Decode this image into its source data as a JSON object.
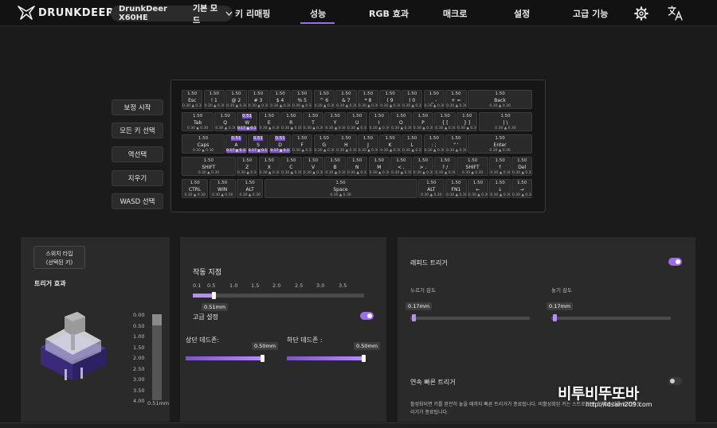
{
  "header": {
    "brand": "DRUNKDEER",
    "device": "DrunkDeer X60HE",
    "mode": "기본 모드",
    "tabs": [
      {
        "label": "키 리매핑"
      },
      {
        "label": "성능"
      },
      {
        "label": "RGB 효과"
      },
      {
        "label": "매크로"
      },
      {
        "label": "설정"
      },
      {
        "label": "고급 기능"
      }
    ],
    "active_tab": "성능",
    "icons": {
      "settings": "gear-icon",
      "language": "translate-icon"
    },
    "accent": "#9b6ee8"
  },
  "side_buttons": [
    "보정 시작",
    "모든 키 선택",
    "역선택",
    "지우기",
    "WASD 선택"
  ],
  "keyboard": {
    "default_value": "1.50",
    "selected_value": "0.51",
    "range_default": "0.30 ▲ 0.30",
    "range_selected": "0.17 ▲ 0.17",
    "rows": [
      [
        {
          "label": "Esc"
        },
        {
          "label": "! 1"
        },
        {
          "label": "@ 2"
        },
        {
          "label": "# 3"
        },
        {
          "label": "$ 4"
        },
        {
          "label": "% 5"
        },
        {
          "label": "^ 6"
        },
        {
          "label": "& 7"
        },
        {
          "label": "* 8"
        },
        {
          "label": "( 9"
        },
        {
          "label": ") 0"
        },
        {
          "label": "_ -"
        },
        {
          "label": "+ ="
        },
        {
          "label": "Back"
        }
      ],
      [
        {
          "label": "Tab"
        },
        {
          "label": "Q"
        },
        {
          "label": "W",
          "selected": true
        },
        {
          "label": "E"
        },
        {
          "label": "R"
        },
        {
          "label": "T"
        },
        {
          "label": "Y"
        },
        {
          "label": "U"
        },
        {
          "label": "I"
        },
        {
          "label": "O"
        },
        {
          "label": "P"
        },
        {
          "label": "{ ["
        },
        {
          "label": "} ]"
        },
        {
          "label": "| \\"
        }
      ],
      [
        {
          "label": "Caps"
        },
        {
          "label": "A",
          "selected": true
        },
        {
          "label": "S",
          "selected": true
        },
        {
          "label": "D",
          "selected": true
        },
        {
          "label": "F"
        },
        {
          "label": "G"
        },
        {
          "label": "H"
        },
        {
          "label": "J"
        },
        {
          "label": "K"
        },
        {
          "label": "L"
        },
        {
          "label": ": ;"
        },
        {
          "label": "\" '"
        },
        {
          "label": "Enter"
        }
      ],
      [
        {
          "label": "SHIFT"
        },
        {
          "label": "Z"
        },
        {
          "label": "X"
        },
        {
          "label": "C"
        },
        {
          "label": "V"
        },
        {
          "label": "B"
        },
        {
          "label": "N"
        },
        {
          "label": "M"
        },
        {
          "label": "< ,"
        },
        {
          "label": "> ."
        },
        {
          "label": "? /"
        },
        {
          "label": "SHIFT"
        },
        {
          "label": "↑"
        },
        {
          "label": "Del"
        }
      ],
      [
        {
          "label": "CTRL"
        },
        {
          "label": "WIN"
        },
        {
          "label": "ALT"
        },
        {
          "label": "Space"
        },
        {
          "label": "ALT"
        },
        {
          "label": "FN1"
        },
        {
          "label": "←"
        },
        {
          "label": "↓"
        },
        {
          "label": "→"
        }
      ]
    ]
  },
  "switch_panel": {
    "switch_type_line1": "스위치 타입",
    "switch_type_line2": "(선택된 키)",
    "trigger_effect": "트리거 효과",
    "scale": [
      "0.00",
      "0.50",
      "1.00",
      "1.50",
      "2.00",
      "2.50",
      "3.00",
      "3.50",
      "4.00"
    ],
    "current": "0.51mm",
    "current_fraction": 0.1275
  },
  "actuation_panel": {
    "title": "작동 지점",
    "ticks": [
      "0.1",
      "0.5",
      "1.0",
      "1.5",
      "2.0",
      "2.5",
      "3.0",
      "3.5"
    ],
    "value": "0.51mm",
    "value_fraction": 0.12,
    "advanced_label": "고급 설정",
    "advanced_on": true,
    "top_deadzone_label": "상단 데드존:",
    "top_deadzone_value": "0.50mm",
    "bottom_deadzone_label": "하단 데드존 :",
    "bottom_deadzone_value": "0.50mm"
  },
  "rapid_panel": {
    "title": "래피드 트리거",
    "enabled": true,
    "press_label": "누르기 감도",
    "press_value": "0.17mm",
    "release_label": "놓기 감도",
    "release_value": "0.17mm",
    "continuous_label": "연속 빠른 트리거",
    "continuous_enabled": false,
    "desc_line1": "활성화되면 키를 완전히 놓을 때까지 빠른 트리거가 종료됩니다. 비활성화된 키는 스트로크 순 첫째로 키를 놓으면 트",
    "desc_line2": "리거가 종료됩니다."
  },
  "watermark": {
    "brand": "비투비뚜또바",
    "url": "http://idsam209.com"
  }
}
